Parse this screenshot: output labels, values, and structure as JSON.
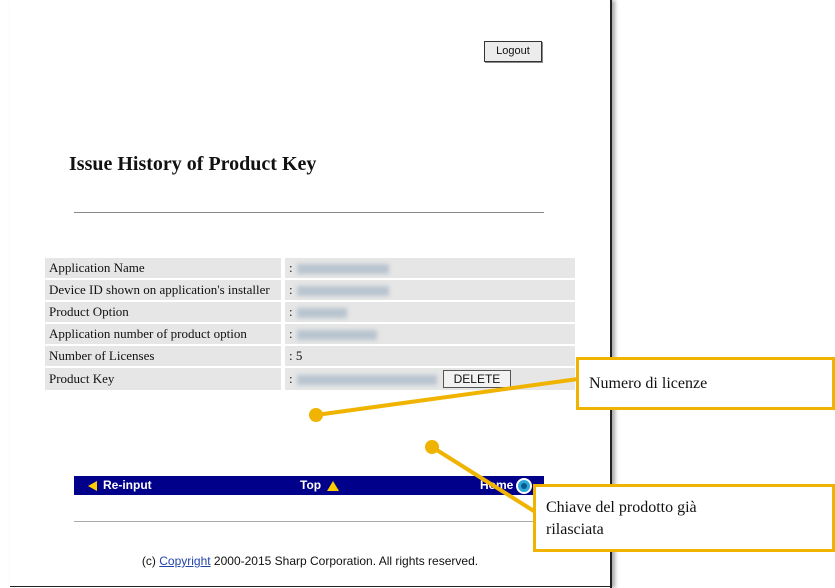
{
  "header": {
    "logout_label": "Logout"
  },
  "page_title": "Issue History of Product Key",
  "info_rows": [
    {
      "label": "Application Name",
      "value": ":"
    },
    {
      "label": "Device ID shown on application's installer",
      "value": ":"
    },
    {
      "label": "Product Option",
      "value": ":"
    },
    {
      "label": "Application number of product option",
      "value": ":"
    },
    {
      "label": "Number of Licenses",
      "value": ": 5"
    },
    {
      "label": "Product Key",
      "value": ":"
    }
  ],
  "delete_label": "DELETE",
  "nav": {
    "reinput": "Re-input",
    "top": "Top",
    "home": "Home"
  },
  "footer": {
    "prefix": "(c) ",
    "link": "Copyright",
    "suffix": " 2000-2015 Sharp Corporation. All rights reserved."
  },
  "callouts": {
    "licenses": "Numero di licenze",
    "key_line1": "Chiave del prodotto già",
    "key_line2": "rilasciata"
  },
  "colors": {
    "accent": "#f0b400",
    "nav_bg": "#00008b",
    "nav_icon": "#ffcc00"
  }
}
